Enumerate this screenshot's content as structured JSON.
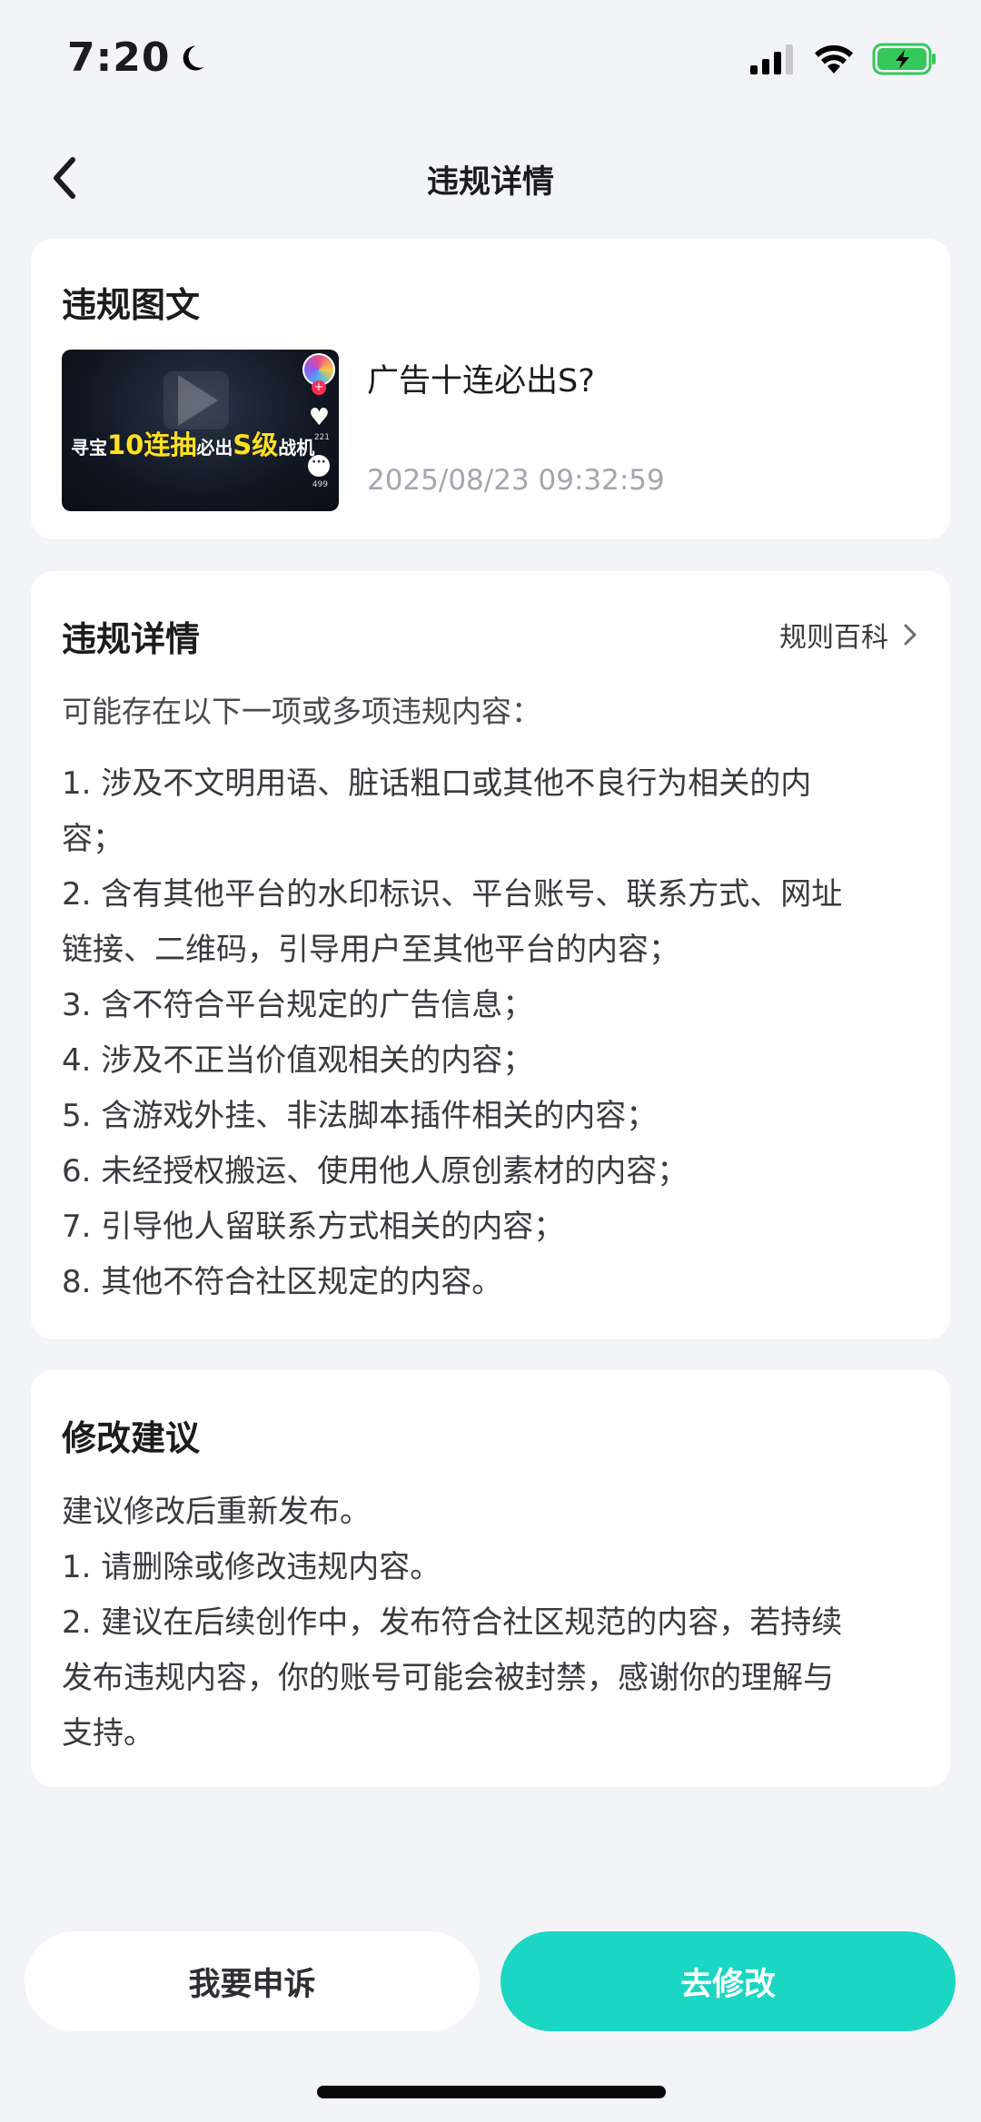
{
  "status_bar": {
    "time": "7:20",
    "moon_icon": "moon-icon",
    "signal_icon": "cellular-signal-icon",
    "wifi_icon": "wifi-icon",
    "battery_icon": "battery-charging-icon",
    "battery_color": "#34c759"
  },
  "nav": {
    "title": "违规详情",
    "back_icon": "chevron-left-icon"
  },
  "violating_post": {
    "section_title": "违规图文",
    "thumbnail": {
      "text_prefix": "寻宝",
      "text_highlight1": "10连抽",
      "text_mid": "必出",
      "text_highlight2": "S级",
      "text_suffix": "战机",
      "like_count": "221",
      "comment_count": "499"
    },
    "title": "广告十连必出S?",
    "time": "2025/08/23 09:32:59"
  },
  "violation_details": {
    "section_title": "违规详情",
    "rules_link": "规则百科",
    "intro": "可能存在以下一项或多项违规内容：",
    "items": [
      "1. 涉及不文明用语、脏话粗口或其他不良行为相关的内",
      "容；",
      "2. 含有其他平台的水印标识、平台账号、联系方式、网址",
      "链接、二维码，引导用户至其他平台的内容；",
      "3. 含不符合平台规定的广告信息；",
      "4. 涉及不正当价值观相关的内容；",
      "5. 含游戏外挂、非法脚本插件相关的内容；",
      "6. 未经授权搬运、使用他人原创素材的内容；",
      "7. 引导他人留联系方式相关的内容；",
      "8. 其他不符合社区规定的内容。"
    ]
  },
  "suggestions": {
    "section_title": "修改建议",
    "lines": [
      "建议修改后重新发布。",
      "1. 请删除或修改违规内容。",
      "2. 建议在后续创作中，发布符合社区规范的内容，若持续",
      "发布违规内容，你的账号可能会被封禁，感谢你的理解与",
      "支持。"
    ]
  },
  "actions": {
    "appeal_label": "我要申诉",
    "modify_label": "去修改",
    "accent_color": "#1bd6c2"
  }
}
